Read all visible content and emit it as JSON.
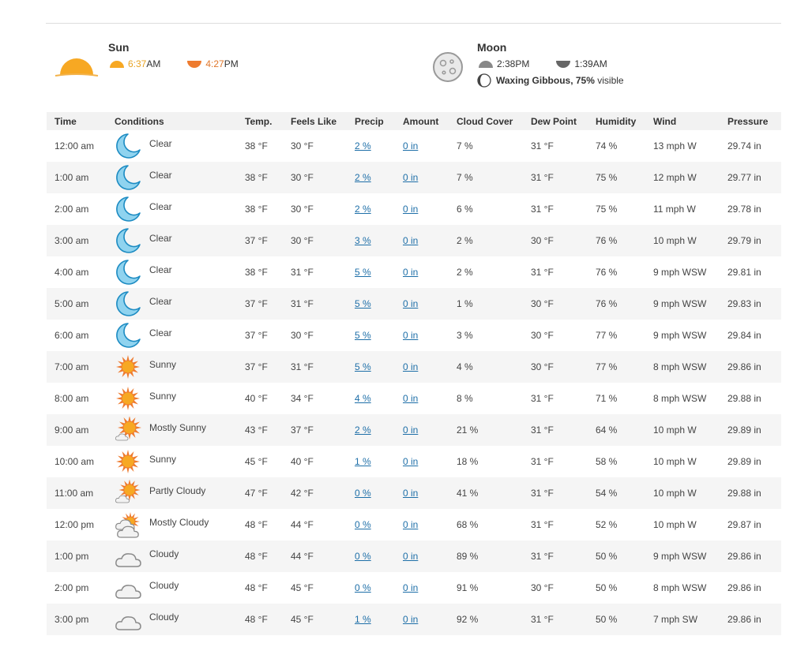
{
  "sun": {
    "title": "Sun",
    "sunrise": "6:37",
    "sunrise_suffix": "AM",
    "sunset": "4:27",
    "sunset_suffix": "PM"
  },
  "moon": {
    "title": "Moon",
    "moonrise": "2:38PM",
    "moonset": "1:39AM",
    "phase_name": "Waxing Gibbous, 75%",
    "phase_suffix": " visible"
  },
  "table": {
    "headers": {
      "time": "Time",
      "conditions": "Conditions",
      "temp": "Temp.",
      "feels": "Feels Like",
      "precip": "Precip",
      "amount": "Amount",
      "cloud": "Cloud Cover",
      "dew": "Dew Point",
      "humidity": "Humidity",
      "wind": "Wind",
      "pressure": "Pressure"
    },
    "rows": [
      {
        "time": "12:00 am",
        "icon": "moon-icon",
        "cond": "Clear",
        "temp": "38 °F",
        "feels": "30 °F",
        "precip": "2 %",
        "amount": "0 in",
        "cloud": "7 %",
        "dew": "31 °F",
        "hum": "74 %",
        "wind": "13 mph W",
        "press": "29.74 in"
      },
      {
        "time": "1:00 am",
        "icon": "moon-icon",
        "cond": "Clear",
        "temp": "38 °F",
        "feels": "30 °F",
        "precip": "2 %",
        "amount": "0 in",
        "cloud": "7 %",
        "dew": "31 °F",
        "hum": "75 %",
        "wind": "12 mph W",
        "press": "29.77 in"
      },
      {
        "time": "2:00 am",
        "icon": "moon-icon",
        "cond": "Clear",
        "temp": "38 °F",
        "feels": "30 °F",
        "precip": "2 %",
        "amount": "0 in",
        "cloud": "6 %",
        "dew": "31 °F",
        "hum": "75 %",
        "wind": "11 mph W",
        "press": "29.78 in"
      },
      {
        "time": "3:00 am",
        "icon": "moon-icon",
        "cond": "Clear",
        "temp": "37 °F",
        "feels": "30 °F",
        "precip": "3 %",
        "amount": "0 in",
        "cloud": "2 %",
        "dew": "30 °F",
        "hum": "76 %",
        "wind": "10 mph W",
        "press": "29.79 in"
      },
      {
        "time": "4:00 am",
        "icon": "moon-icon",
        "cond": "Clear",
        "temp": "38 °F",
        "feels": "31 °F",
        "precip": "5 %",
        "amount": "0 in",
        "cloud": "2 %",
        "dew": "31 °F",
        "hum": "76 %",
        "wind": "9 mph WSW",
        "press": "29.81 in"
      },
      {
        "time": "5:00 am",
        "icon": "moon-icon",
        "cond": "Clear",
        "temp": "37 °F",
        "feels": "31 °F",
        "precip": "5 %",
        "amount": "0 in",
        "cloud": "1 %",
        "dew": "30 °F",
        "hum": "76 %",
        "wind": "9 mph WSW",
        "press": "29.83 in"
      },
      {
        "time": "6:00 am",
        "icon": "moon-icon",
        "cond": "Clear",
        "temp": "37 °F",
        "feels": "30 °F",
        "precip": "5 %",
        "amount": "0 in",
        "cloud": "3 %",
        "dew": "30 °F",
        "hum": "77 %",
        "wind": "9 mph WSW",
        "press": "29.84 in"
      },
      {
        "time": "7:00 am",
        "icon": "sun-icon",
        "cond": "Sunny",
        "temp": "37 °F",
        "feels": "31 °F",
        "precip": "5 %",
        "amount": "0 in",
        "cloud": "4 %",
        "dew": "30 °F",
        "hum": "77 %",
        "wind": "8 mph WSW",
        "press": "29.86 in"
      },
      {
        "time": "8:00 am",
        "icon": "sun-icon",
        "cond": "Sunny",
        "temp": "40 °F",
        "feels": "34 °F",
        "precip": "4 %",
        "amount": "0 in",
        "cloud": "8 %",
        "dew": "31 °F",
        "hum": "71 %",
        "wind": "8 mph WSW",
        "press": "29.88 in"
      },
      {
        "time": "9:00 am",
        "icon": "mostly-sunny-icon",
        "cond": "Mostly Sunny",
        "temp": "43 °F",
        "feels": "37 °F",
        "precip": "2 %",
        "amount": "0 in",
        "cloud": "21 %",
        "dew": "31 °F",
        "hum": "64 %",
        "wind": "10 mph W",
        "press": "29.89 in"
      },
      {
        "time": "10:00 am",
        "icon": "sun-icon",
        "cond": "Sunny",
        "temp": "45 °F",
        "feels": "40 °F",
        "precip": "1 %",
        "amount": "0 in",
        "cloud": "18 %",
        "dew": "31 °F",
        "hum": "58 %",
        "wind": "10 mph W",
        "press": "29.89 in"
      },
      {
        "time": "11:00 am",
        "icon": "partly-cloudy-icon",
        "cond": "Partly Cloudy",
        "temp": "47 °F",
        "feels": "42 °F",
        "precip": "0 %",
        "amount": "0 in",
        "cloud": "41 %",
        "dew": "31 °F",
        "hum": "54 %",
        "wind": "10 mph W",
        "press": "29.88 in"
      },
      {
        "time": "12:00 pm",
        "icon": "mostly-cloudy-icon",
        "cond": "Mostly Cloudy",
        "temp": "48 °F",
        "feels": "44 °F",
        "precip": "0 %",
        "amount": "0 in",
        "cloud": "68 %",
        "dew": "31 °F",
        "hum": "52 %",
        "wind": "10 mph W",
        "press": "29.87 in"
      },
      {
        "time": "1:00 pm",
        "icon": "cloud-icon",
        "cond": "Cloudy",
        "temp": "48 °F",
        "feels": "44 °F",
        "precip": "0 %",
        "amount": "0 in",
        "cloud": "89 %",
        "dew": "31 °F",
        "hum": "50 %",
        "wind": "9 mph WSW",
        "press": "29.86 in"
      },
      {
        "time": "2:00 pm",
        "icon": "cloud-icon",
        "cond": "Cloudy",
        "temp": "48 °F",
        "feels": "45 °F",
        "precip": "0 %",
        "amount": "0 in",
        "cloud": "91 %",
        "dew": "30 °F",
        "hum": "50 %",
        "wind": "8 mph WSW",
        "press": "29.86 in"
      },
      {
        "time": "3:00 pm",
        "icon": "cloud-icon",
        "cond": "Cloudy",
        "temp": "48 °F",
        "feels": "45 °F",
        "precip": "1 %",
        "amount": "0 in",
        "cloud": "92 %",
        "dew": "31 °F",
        "hum": "50 %",
        "wind": "7 mph SW",
        "press": "29.86 in"
      }
    ]
  },
  "colors": {
    "sun_orange": "#f7a823",
    "sunset_orange": "#ee7b2f",
    "moon_blue": "#8fd3ef",
    "moon_stroke": "#1c8bc2",
    "link": "#1e6fa8"
  }
}
